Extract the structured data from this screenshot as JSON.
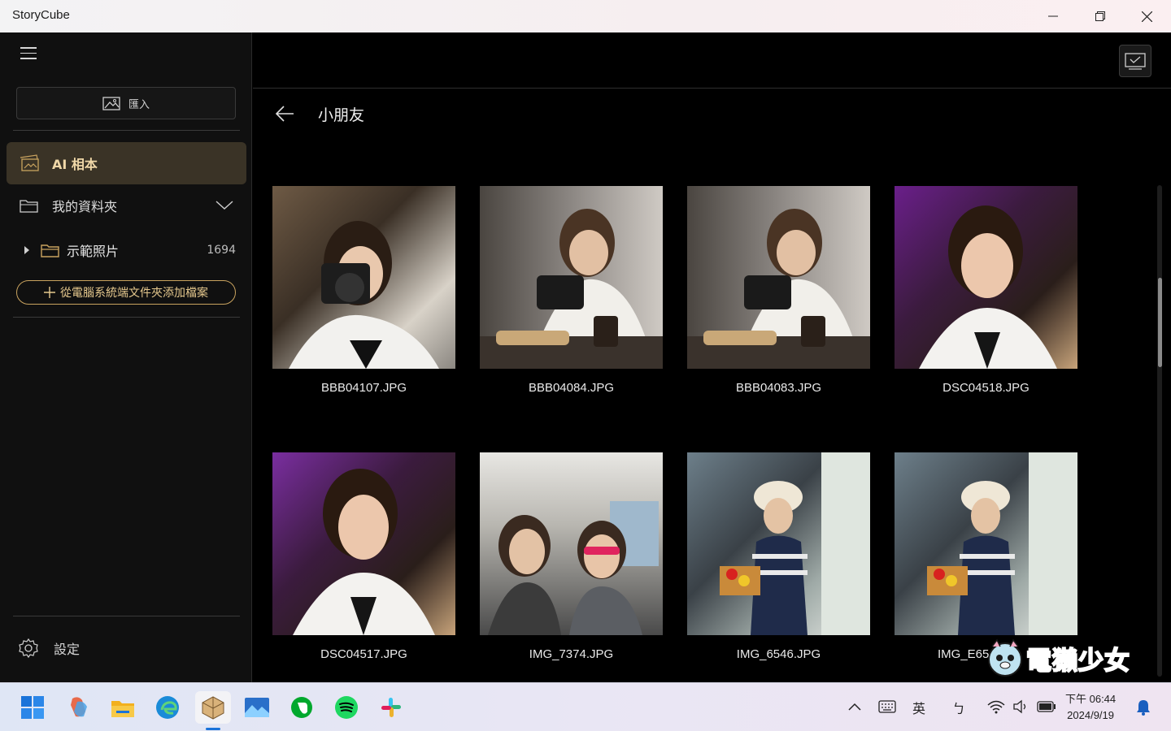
{
  "window": {
    "title": "StoryCube"
  },
  "sidebar": {
    "import_label": "匯入",
    "ai_album_label": "AI 相本",
    "my_folders_label": "我的資料夾",
    "sample_folder": {
      "label": "示範照片",
      "count": "1694"
    },
    "add_files_label": "從電腦系統端文件夾添加檔案",
    "settings_label": "設定"
  },
  "main": {
    "album_title": "小朋友",
    "photos": [
      {
        "name": "BBB04107.JPG"
      },
      {
        "name": "BBB04084.JPG"
      },
      {
        "name": "BBB04083.JPG"
      },
      {
        "name": "DSC04518.JPG"
      },
      {
        "name": "DSC04517.JPG"
      },
      {
        "name": "IMG_7374.JPG"
      },
      {
        "name": "IMG_6546.JPG"
      },
      {
        "name": "IMG_E65"
      }
    ]
  },
  "taskbar": {
    "apps": [
      "windows-start",
      "copilot",
      "file-explorer",
      "edge",
      "storycube",
      "photos",
      "evernote",
      "spotify",
      "slack"
    ],
    "ime_lang": "英",
    "ime_mode": "ㄅ",
    "time": "下午 06:44",
    "date": "2024/9/19"
  },
  "watermark": {
    "text": "電獺少女"
  },
  "colors": {
    "accent": "#c9a35f",
    "selected_bg": "#3a3326",
    "ai_label": "#f0d8a8"
  }
}
